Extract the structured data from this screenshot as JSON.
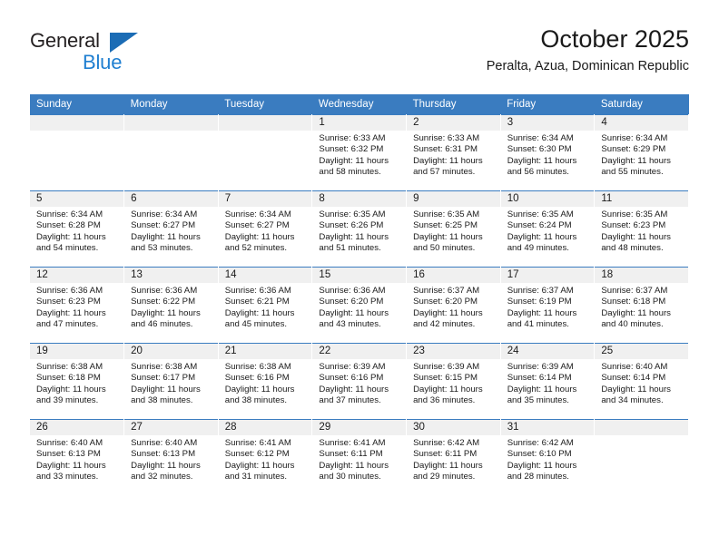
{
  "brand": {
    "name_part1": "General",
    "name_part2": "Blue",
    "color_dark": "#231f20",
    "color_blue": "#1f7fd1",
    "triangle_color": "#1b6cb5"
  },
  "header": {
    "title": "October 2025",
    "subtitle": "Peralta, Azua, Dominican Republic"
  },
  "theme": {
    "header_row_bg": "#3a7cc0",
    "daynum_bg": "#f0f0f0",
    "grid_line": "#3a7cc0"
  },
  "calendar": {
    "weekday_headers": [
      "Sunday",
      "Monday",
      "Tuesday",
      "Wednesday",
      "Thursday",
      "Friday",
      "Saturday"
    ],
    "weeks": [
      [
        {
          "day": "",
          "sunrise": "",
          "sunset": "",
          "daylight": "",
          "daylight2": ""
        },
        {
          "day": "",
          "sunrise": "",
          "sunset": "",
          "daylight": "",
          "daylight2": ""
        },
        {
          "day": "",
          "sunrise": "",
          "sunset": "",
          "daylight": "",
          "daylight2": ""
        },
        {
          "day": "1",
          "sunrise": "Sunrise: 6:33 AM",
          "sunset": "Sunset: 6:32 PM",
          "daylight": "Daylight: 11 hours",
          "daylight2": "and 58 minutes."
        },
        {
          "day": "2",
          "sunrise": "Sunrise: 6:33 AM",
          "sunset": "Sunset: 6:31 PM",
          "daylight": "Daylight: 11 hours",
          "daylight2": "and 57 minutes."
        },
        {
          "day": "3",
          "sunrise": "Sunrise: 6:34 AM",
          "sunset": "Sunset: 6:30 PM",
          "daylight": "Daylight: 11 hours",
          "daylight2": "and 56 minutes."
        },
        {
          "day": "4",
          "sunrise": "Sunrise: 6:34 AM",
          "sunset": "Sunset: 6:29 PM",
          "daylight": "Daylight: 11 hours",
          "daylight2": "and 55 minutes."
        }
      ],
      [
        {
          "day": "5",
          "sunrise": "Sunrise: 6:34 AM",
          "sunset": "Sunset: 6:28 PM",
          "daylight": "Daylight: 11 hours",
          "daylight2": "and 54 minutes."
        },
        {
          "day": "6",
          "sunrise": "Sunrise: 6:34 AM",
          "sunset": "Sunset: 6:27 PM",
          "daylight": "Daylight: 11 hours",
          "daylight2": "and 53 minutes."
        },
        {
          "day": "7",
          "sunrise": "Sunrise: 6:34 AM",
          "sunset": "Sunset: 6:27 PM",
          "daylight": "Daylight: 11 hours",
          "daylight2": "and 52 minutes."
        },
        {
          "day": "8",
          "sunrise": "Sunrise: 6:35 AM",
          "sunset": "Sunset: 6:26 PM",
          "daylight": "Daylight: 11 hours",
          "daylight2": "and 51 minutes."
        },
        {
          "day": "9",
          "sunrise": "Sunrise: 6:35 AM",
          "sunset": "Sunset: 6:25 PM",
          "daylight": "Daylight: 11 hours",
          "daylight2": "and 50 minutes."
        },
        {
          "day": "10",
          "sunrise": "Sunrise: 6:35 AM",
          "sunset": "Sunset: 6:24 PM",
          "daylight": "Daylight: 11 hours",
          "daylight2": "and 49 minutes."
        },
        {
          "day": "11",
          "sunrise": "Sunrise: 6:35 AM",
          "sunset": "Sunset: 6:23 PM",
          "daylight": "Daylight: 11 hours",
          "daylight2": "and 48 minutes."
        }
      ],
      [
        {
          "day": "12",
          "sunrise": "Sunrise: 6:36 AM",
          "sunset": "Sunset: 6:23 PM",
          "daylight": "Daylight: 11 hours",
          "daylight2": "and 47 minutes."
        },
        {
          "day": "13",
          "sunrise": "Sunrise: 6:36 AM",
          "sunset": "Sunset: 6:22 PM",
          "daylight": "Daylight: 11 hours",
          "daylight2": "and 46 minutes."
        },
        {
          "day": "14",
          "sunrise": "Sunrise: 6:36 AM",
          "sunset": "Sunset: 6:21 PM",
          "daylight": "Daylight: 11 hours",
          "daylight2": "and 45 minutes."
        },
        {
          "day": "15",
          "sunrise": "Sunrise: 6:36 AM",
          "sunset": "Sunset: 6:20 PM",
          "daylight": "Daylight: 11 hours",
          "daylight2": "and 43 minutes."
        },
        {
          "day": "16",
          "sunrise": "Sunrise: 6:37 AM",
          "sunset": "Sunset: 6:20 PM",
          "daylight": "Daylight: 11 hours",
          "daylight2": "and 42 minutes."
        },
        {
          "day": "17",
          "sunrise": "Sunrise: 6:37 AM",
          "sunset": "Sunset: 6:19 PM",
          "daylight": "Daylight: 11 hours",
          "daylight2": "and 41 minutes."
        },
        {
          "day": "18",
          "sunrise": "Sunrise: 6:37 AM",
          "sunset": "Sunset: 6:18 PM",
          "daylight": "Daylight: 11 hours",
          "daylight2": "and 40 minutes."
        }
      ],
      [
        {
          "day": "19",
          "sunrise": "Sunrise: 6:38 AM",
          "sunset": "Sunset: 6:18 PM",
          "daylight": "Daylight: 11 hours",
          "daylight2": "and 39 minutes."
        },
        {
          "day": "20",
          "sunrise": "Sunrise: 6:38 AM",
          "sunset": "Sunset: 6:17 PM",
          "daylight": "Daylight: 11 hours",
          "daylight2": "and 38 minutes."
        },
        {
          "day": "21",
          "sunrise": "Sunrise: 6:38 AM",
          "sunset": "Sunset: 6:16 PM",
          "daylight": "Daylight: 11 hours",
          "daylight2": "and 38 minutes."
        },
        {
          "day": "22",
          "sunrise": "Sunrise: 6:39 AM",
          "sunset": "Sunset: 6:16 PM",
          "daylight": "Daylight: 11 hours",
          "daylight2": "and 37 minutes."
        },
        {
          "day": "23",
          "sunrise": "Sunrise: 6:39 AM",
          "sunset": "Sunset: 6:15 PM",
          "daylight": "Daylight: 11 hours",
          "daylight2": "and 36 minutes."
        },
        {
          "day": "24",
          "sunrise": "Sunrise: 6:39 AM",
          "sunset": "Sunset: 6:14 PM",
          "daylight": "Daylight: 11 hours",
          "daylight2": "and 35 minutes."
        },
        {
          "day": "25",
          "sunrise": "Sunrise: 6:40 AM",
          "sunset": "Sunset: 6:14 PM",
          "daylight": "Daylight: 11 hours",
          "daylight2": "and 34 minutes."
        }
      ],
      [
        {
          "day": "26",
          "sunrise": "Sunrise: 6:40 AM",
          "sunset": "Sunset: 6:13 PM",
          "daylight": "Daylight: 11 hours",
          "daylight2": "and 33 minutes."
        },
        {
          "day": "27",
          "sunrise": "Sunrise: 6:40 AM",
          "sunset": "Sunset: 6:13 PM",
          "daylight": "Daylight: 11 hours",
          "daylight2": "and 32 minutes."
        },
        {
          "day": "28",
          "sunrise": "Sunrise: 6:41 AM",
          "sunset": "Sunset: 6:12 PM",
          "daylight": "Daylight: 11 hours",
          "daylight2": "and 31 minutes."
        },
        {
          "day": "29",
          "sunrise": "Sunrise: 6:41 AM",
          "sunset": "Sunset: 6:11 PM",
          "daylight": "Daylight: 11 hours",
          "daylight2": "and 30 minutes."
        },
        {
          "day": "30",
          "sunrise": "Sunrise: 6:42 AM",
          "sunset": "Sunset: 6:11 PM",
          "daylight": "Daylight: 11 hours",
          "daylight2": "and 29 minutes."
        },
        {
          "day": "31",
          "sunrise": "Sunrise: 6:42 AM",
          "sunset": "Sunset: 6:10 PM",
          "daylight": "Daylight: 11 hours",
          "daylight2": "and 28 minutes."
        },
        {
          "day": "",
          "sunrise": "",
          "sunset": "",
          "daylight": "",
          "daylight2": ""
        }
      ]
    ]
  }
}
